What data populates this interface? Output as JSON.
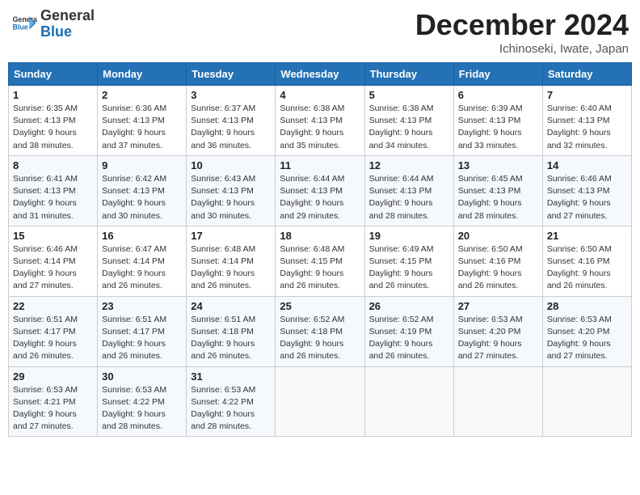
{
  "header": {
    "logo_general": "General",
    "logo_blue": "Blue",
    "month": "December 2024",
    "location": "Ichinoseki, Iwate, Japan"
  },
  "weekdays": [
    "Sunday",
    "Monday",
    "Tuesday",
    "Wednesday",
    "Thursday",
    "Friday",
    "Saturday"
  ],
  "weeks": [
    [
      {
        "day": "1",
        "sunrise": "Sunrise: 6:35 AM",
        "sunset": "Sunset: 4:13 PM",
        "daylight": "Daylight: 9 hours and 38 minutes."
      },
      {
        "day": "2",
        "sunrise": "Sunrise: 6:36 AM",
        "sunset": "Sunset: 4:13 PM",
        "daylight": "Daylight: 9 hours and 37 minutes."
      },
      {
        "day": "3",
        "sunrise": "Sunrise: 6:37 AM",
        "sunset": "Sunset: 4:13 PM",
        "daylight": "Daylight: 9 hours and 36 minutes."
      },
      {
        "day": "4",
        "sunrise": "Sunrise: 6:38 AM",
        "sunset": "Sunset: 4:13 PM",
        "daylight": "Daylight: 9 hours and 35 minutes."
      },
      {
        "day": "5",
        "sunrise": "Sunrise: 6:38 AM",
        "sunset": "Sunset: 4:13 PM",
        "daylight": "Daylight: 9 hours and 34 minutes."
      },
      {
        "day": "6",
        "sunrise": "Sunrise: 6:39 AM",
        "sunset": "Sunset: 4:13 PM",
        "daylight": "Daylight: 9 hours and 33 minutes."
      },
      {
        "day": "7",
        "sunrise": "Sunrise: 6:40 AM",
        "sunset": "Sunset: 4:13 PM",
        "daylight": "Daylight: 9 hours and 32 minutes."
      }
    ],
    [
      {
        "day": "8",
        "sunrise": "Sunrise: 6:41 AM",
        "sunset": "Sunset: 4:13 PM",
        "daylight": "Daylight: 9 hours and 31 minutes."
      },
      {
        "day": "9",
        "sunrise": "Sunrise: 6:42 AM",
        "sunset": "Sunset: 4:13 PM",
        "daylight": "Daylight: 9 hours and 30 minutes."
      },
      {
        "day": "10",
        "sunrise": "Sunrise: 6:43 AM",
        "sunset": "Sunset: 4:13 PM",
        "daylight": "Daylight: 9 hours and 30 minutes."
      },
      {
        "day": "11",
        "sunrise": "Sunrise: 6:44 AM",
        "sunset": "Sunset: 4:13 PM",
        "daylight": "Daylight: 9 hours and 29 minutes."
      },
      {
        "day": "12",
        "sunrise": "Sunrise: 6:44 AM",
        "sunset": "Sunset: 4:13 PM",
        "daylight": "Daylight: 9 hours and 28 minutes."
      },
      {
        "day": "13",
        "sunrise": "Sunrise: 6:45 AM",
        "sunset": "Sunset: 4:13 PM",
        "daylight": "Daylight: 9 hours and 28 minutes."
      },
      {
        "day": "14",
        "sunrise": "Sunrise: 6:46 AM",
        "sunset": "Sunset: 4:13 PM",
        "daylight": "Daylight: 9 hours and 27 minutes."
      }
    ],
    [
      {
        "day": "15",
        "sunrise": "Sunrise: 6:46 AM",
        "sunset": "Sunset: 4:14 PM",
        "daylight": "Daylight: 9 hours and 27 minutes."
      },
      {
        "day": "16",
        "sunrise": "Sunrise: 6:47 AM",
        "sunset": "Sunset: 4:14 PM",
        "daylight": "Daylight: 9 hours and 26 minutes."
      },
      {
        "day": "17",
        "sunrise": "Sunrise: 6:48 AM",
        "sunset": "Sunset: 4:14 PM",
        "daylight": "Daylight: 9 hours and 26 minutes."
      },
      {
        "day": "18",
        "sunrise": "Sunrise: 6:48 AM",
        "sunset": "Sunset: 4:15 PM",
        "daylight": "Daylight: 9 hours and 26 minutes."
      },
      {
        "day": "19",
        "sunrise": "Sunrise: 6:49 AM",
        "sunset": "Sunset: 4:15 PM",
        "daylight": "Daylight: 9 hours and 26 minutes."
      },
      {
        "day": "20",
        "sunrise": "Sunrise: 6:50 AM",
        "sunset": "Sunset: 4:16 PM",
        "daylight": "Daylight: 9 hours and 26 minutes."
      },
      {
        "day": "21",
        "sunrise": "Sunrise: 6:50 AM",
        "sunset": "Sunset: 4:16 PM",
        "daylight": "Daylight: 9 hours and 26 minutes."
      }
    ],
    [
      {
        "day": "22",
        "sunrise": "Sunrise: 6:51 AM",
        "sunset": "Sunset: 4:17 PM",
        "daylight": "Daylight: 9 hours and 26 minutes."
      },
      {
        "day": "23",
        "sunrise": "Sunrise: 6:51 AM",
        "sunset": "Sunset: 4:17 PM",
        "daylight": "Daylight: 9 hours and 26 minutes."
      },
      {
        "day": "24",
        "sunrise": "Sunrise: 6:51 AM",
        "sunset": "Sunset: 4:18 PM",
        "daylight": "Daylight: 9 hours and 26 minutes."
      },
      {
        "day": "25",
        "sunrise": "Sunrise: 6:52 AM",
        "sunset": "Sunset: 4:18 PM",
        "daylight": "Daylight: 9 hours and 26 minutes."
      },
      {
        "day": "26",
        "sunrise": "Sunrise: 6:52 AM",
        "sunset": "Sunset: 4:19 PM",
        "daylight": "Daylight: 9 hours and 26 minutes."
      },
      {
        "day": "27",
        "sunrise": "Sunrise: 6:53 AM",
        "sunset": "Sunset: 4:20 PM",
        "daylight": "Daylight: 9 hours and 27 minutes."
      },
      {
        "day": "28",
        "sunrise": "Sunrise: 6:53 AM",
        "sunset": "Sunset: 4:20 PM",
        "daylight": "Daylight: 9 hours and 27 minutes."
      }
    ],
    [
      {
        "day": "29",
        "sunrise": "Sunrise: 6:53 AM",
        "sunset": "Sunset: 4:21 PM",
        "daylight": "Daylight: 9 hours and 27 minutes."
      },
      {
        "day": "30",
        "sunrise": "Sunrise: 6:53 AM",
        "sunset": "Sunset: 4:22 PM",
        "daylight": "Daylight: 9 hours and 28 minutes."
      },
      {
        "day": "31",
        "sunrise": "Sunrise: 6:53 AM",
        "sunset": "Sunset: 4:22 PM",
        "daylight": "Daylight: 9 hours and 28 minutes."
      },
      null,
      null,
      null,
      null
    ]
  ]
}
